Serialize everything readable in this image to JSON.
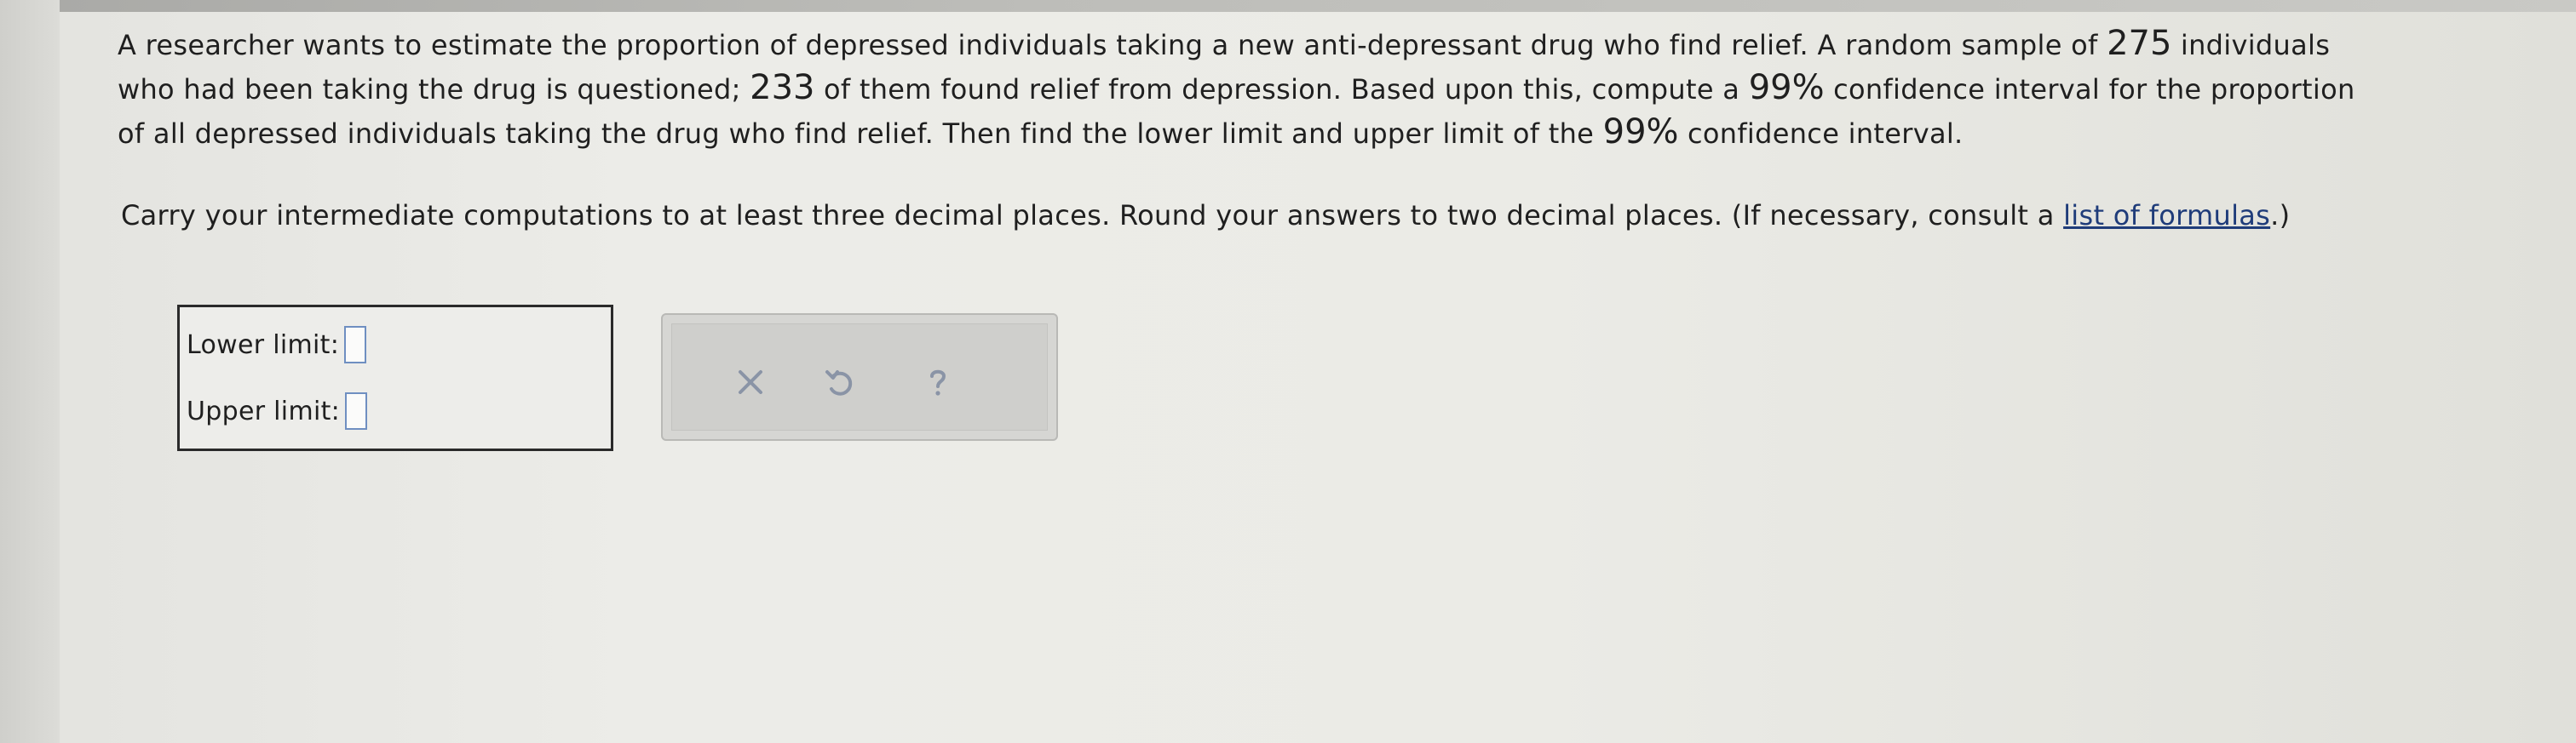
{
  "question": {
    "line1": "A researcher wants to estimate the proportion of depressed individuals taking a new anti-depressant drug who find relief. A random sample of ",
    "sample_size": "275",
    "line1_end": " individuals",
    "line2_start": "who had been taking the drug is questioned; ",
    "successes": "233",
    "line2_end": " of them found relief from depression. Based upon this, compute a ",
    "confidence_1": "99%",
    "line2_tail": " confidence interval for the proportion",
    "line3_start": "of all depressed individuals taking the drug who find relief. Then find the lower limit and upper limit of the ",
    "confidence_2": "99%",
    "line3_end": " confidence interval."
  },
  "instructions": {
    "text": "Carry your intermediate computations to at least three decimal places. Round your answers to two decimal places. (If necessary, consult a ",
    "link_text": "list of formulas",
    "text_end": ".)"
  },
  "answers": {
    "lower_label": "Lower limit:",
    "lower_value": "",
    "upper_label": "Upper limit:",
    "upper_value": ""
  },
  "tools": {
    "clear_icon": "x-icon",
    "undo_icon": "undo-icon",
    "help_icon": "question-icon",
    "icon_color": "#8a94a6"
  }
}
